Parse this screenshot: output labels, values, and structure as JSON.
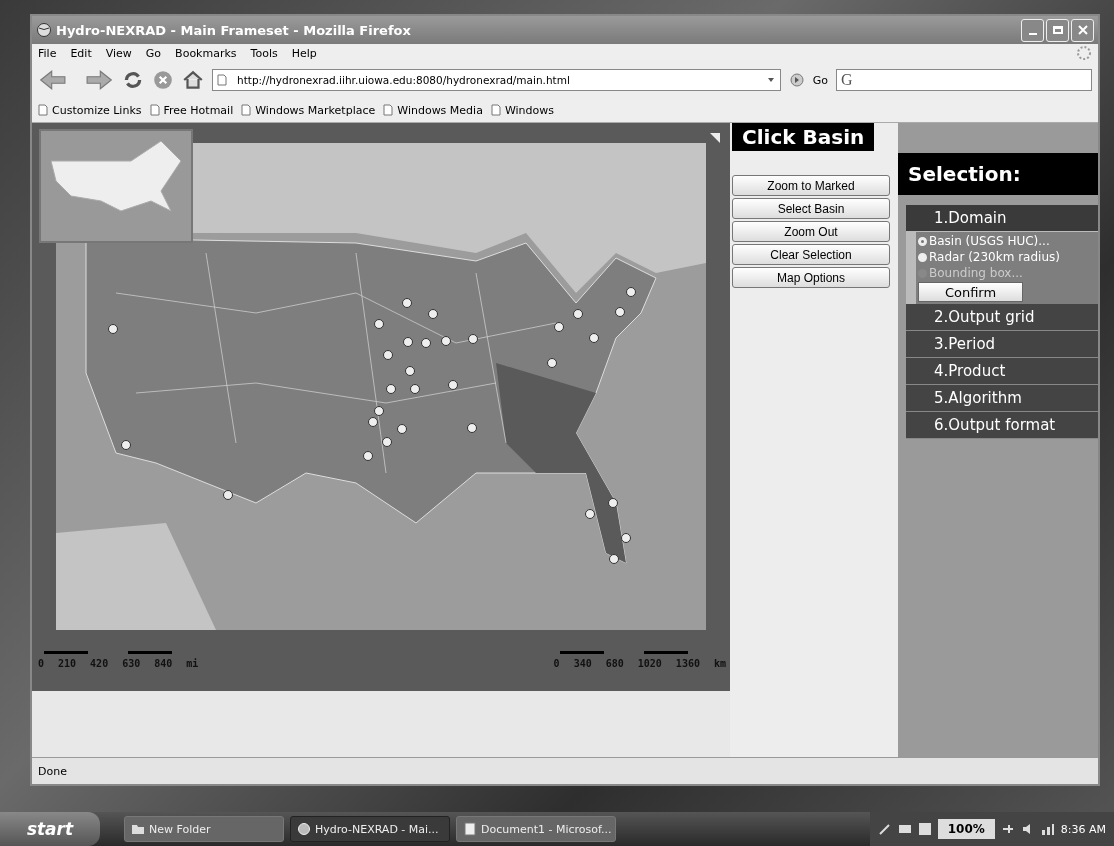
{
  "window": {
    "title": "Hydro-NEXRAD - Main Frameset - Mozilla Firefox"
  },
  "menu": [
    "File",
    "Edit",
    "View",
    "Go",
    "Bookmarks",
    "Tools",
    "Help"
  ],
  "address": {
    "value": "http://hydronexrad.iihr.uiowa.edu:8080/hydronexrad/main.html",
    "go_label": "Go"
  },
  "search": {
    "logo": "G"
  },
  "bookmarks": [
    "Customize Links",
    "Free Hotmail",
    "Windows Marketplace",
    "Windows Media",
    "Windows"
  ],
  "map": {
    "scale_miles": {
      "labels": [
        "0",
        "210",
        "420",
        "630",
        "840"
      ],
      "unit": "mi"
    },
    "scale_km": {
      "labels": [
        "0",
        "340",
        "680",
        "1020",
        "1360"
      ],
      "unit": "km"
    }
  },
  "click_basin": {
    "title": "Click Basin",
    "buttons": [
      "Zoom to Marked",
      "Select Basin",
      "Zoom Out",
      "Clear Selection",
      "Map Options"
    ]
  },
  "selection": {
    "title": "Selection:",
    "steps": [
      {
        "label": "1.Domain",
        "expanded": true,
        "options": [
          {
            "label": "Basin (USGS HUC)...",
            "selected": true,
            "disabled": false
          },
          {
            "label": "Radar (230km radius)",
            "selected": false,
            "disabled": false
          },
          {
            "label": "Bounding box...",
            "selected": false,
            "disabled": true
          }
        ],
        "confirm": "Confirm"
      },
      {
        "label": "2.Output grid",
        "expanded": false
      },
      {
        "label": "3.Period",
        "expanded": false
      },
      {
        "label": "4.Product",
        "expanded": false
      },
      {
        "label": "5.Algorithm",
        "expanded": false
      },
      {
        "label": "6.Output format",
        "expanded": false
      }
    ]
  },
  "status_bar": "Done",
  "taskbar": {
    "start": "start",
    "tasks": [
      {
        "label": "New Folder",
        "kind": "folder",
        "selected": false
      },
      {
        "label": "Hydro-NEXRAD - Mai...",
        "kind": "browser",
        "selected": true
      },
      {
        "label": "Document1 - Microsof...",
        "kind": "document",
        "selected": false
      }
    ],
    "zoom": "100%",
    "clock": "8:36 AM"
  }
}
